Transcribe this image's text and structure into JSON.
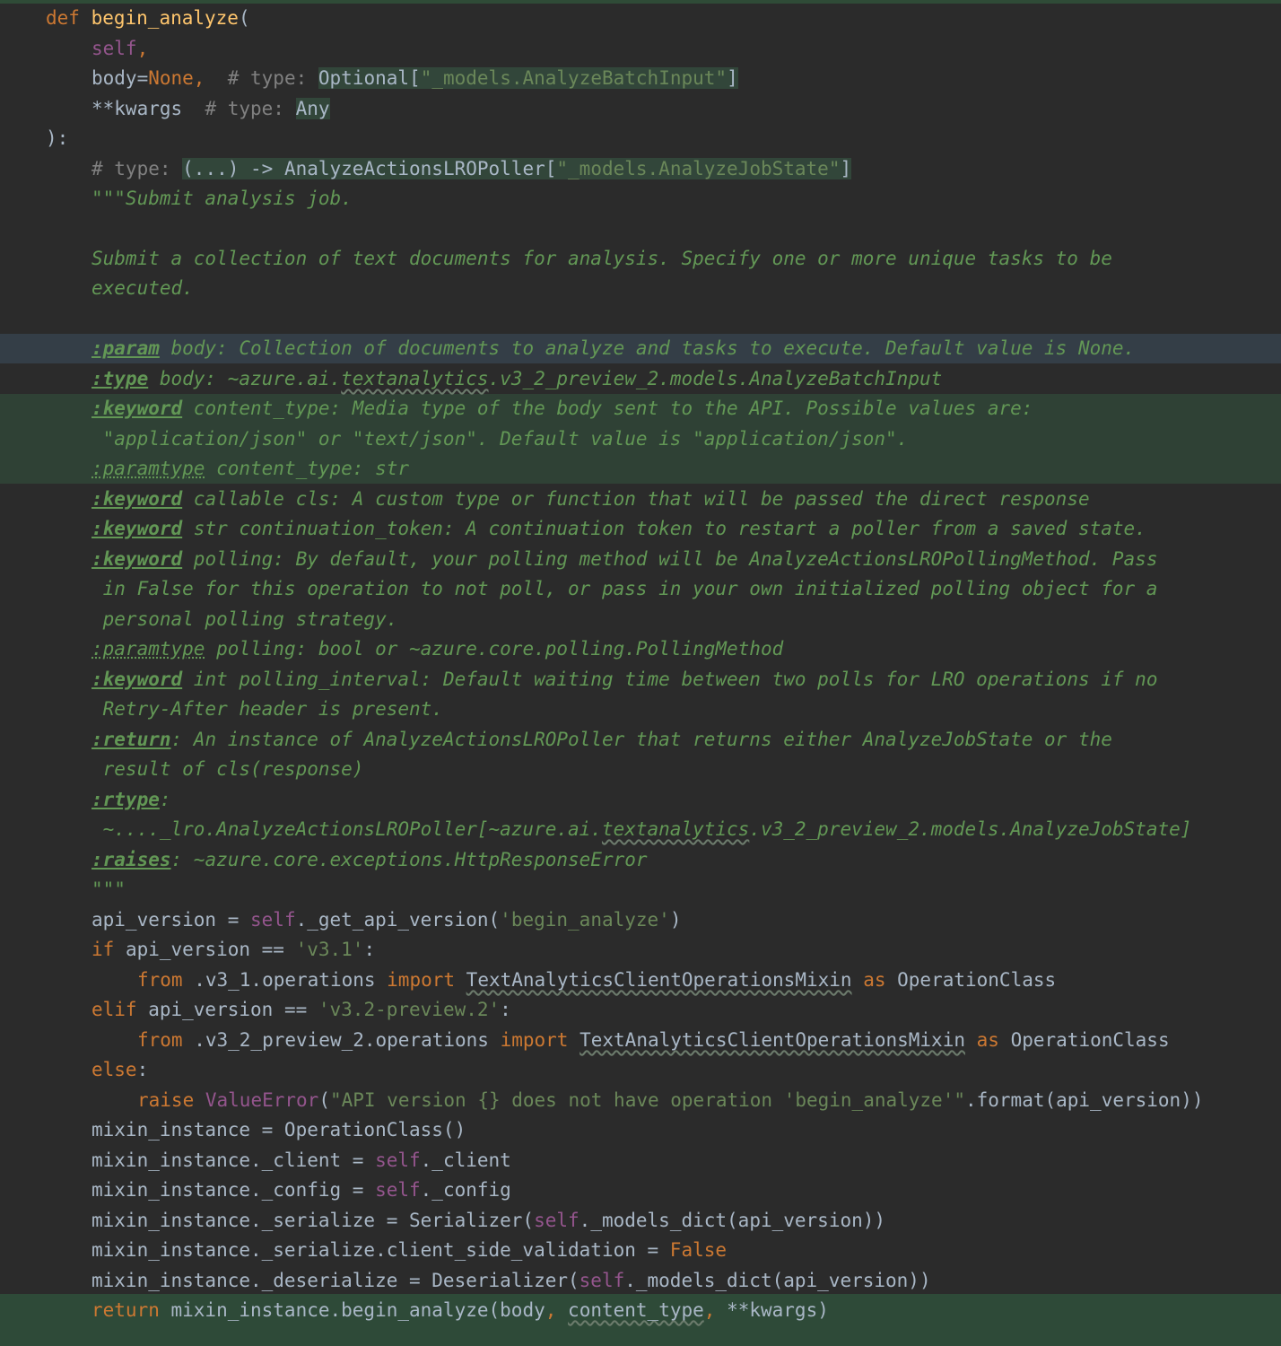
{
  "code": {
    "l1": {
      "kw": "def",
      "fn": "begin_analyze",
      "rest": "("
    },
    "l2": {
      "self": "self",
      "rest": ","
    },
    "l3": {
      "p": "body=",
      "none": "None",
      "sep": ",  ",
      "cmt": "# type: ",
      "hint_a": "Optional[",
      "hint_s": "\"_models.AnalyzeBatchInput\"",
      "hint_b": "]"
    },
    "l4": {
      "p": "**kwargs  ",
      "cmt": "# type: ",
      "hint": "Any"
    },
    "l5": {
      "text": "):"
    },
    "l6": {
      "cmt": "# type: ",
      "hint_a": "(...) -> AnalyzeActionsLROPoller[",
      "hint_s": "\"_models.AnalyzeJobState\"",
      "hint_b": "]"
    },
    "l7": {
      "text": "\"\"\"Submit analysis job."
    },
    "l9": {
      "text": "Submit a collection of text documents for analysis. Specify one or more unique tasks to be"
    },
    "l10": {
      "text": "executed."
    },
    "l12": {
      "tag": ":param",
      "text": " body: Collection of documents to analyze and tasks to execute. Default value is None."
    },
    "l13": {
      "tag": ":type",
      "t1": " body: ~azure.ai.",
      "wavy": "textanalytics",
      "t2": ".v3_2_preview_2.models.AnalyzeBatchInput"
    },
    "l14": {
      "tag": ":keyword",
      "text": " content_type: Media type of the body sent to the API. Possible values are:"
    },
    "l15": {
      "text": " \"application/json\" or \"text/json\". Default value is \"application/json\"."
    },
    "l16": {
      "tag": ":paramtype",
      "text": " content_type: str"
    },
    "l17": {
      "tag": ":keyword",
      "text": " callable cls: A custom type or function that will be passed the direct response"
    },
    "l18": {
      "tag": ":keyword",
      "text": " str continuation_token: A continuation token to restart a poller from a saved state."
    },
    "l19": {
      "tag": ":keyword",
      "text": " polling: By default, your polling method will be AnalyzeActionsLROPollingMethod. Pass"
    },
    "l20": {
      "text": " in False for this operation to not poll, or pass in your own initialized polling object for a"
    },
    "l21": {
      "text": " personal polling strategy."
    },
    "l22": {
      "tag": ":paramtype",
      "text": " polling: bool or ~azure.core.polling.PollingMethod"
    },
    "l23": {
      "tag": ":keyword",
      "text": " int polling_interval: Default waiting time between two polls for LRO operations if no"
    },
    "l24": {
      "text": " Retry-After header is present."
    },
    "l25": {
      "tag": ":return",
      "text": ": An instance of AnalyzeActionsLROPoller that returns either AnalyzeJobState or the"
    },
    "l26": {
      "text": " result of cls(response)"
    },
    "l27": {
      "tag": ":rtype",
      "text": ":"
    },
    "l28": {
      "t1": " ~...._lro.AnalyzeActionsLROPoller[~azure.ai.",
      "wavy": "textanalytics",
      "t2": ".v3_2_preview_2.models.AnalyzeJobState]"
    },
    "l29": {
      "tag": ":raises",
      "text": ": ~azure.core.exceptions.HttpResponseError"
    },
    "l30": {
      "text": "\"\"\""
    },
    "l31": {
      "a": "api_version = ",
      "self": "self",
      "b": "._get_api_version(",
      "s": "'begin_analyze'",
      "c": ")"
    },
    "l32": {
      "kw": "if",
      "a": " api_version == ",
      "s": "'v3.1'",
      "c": ":"
    },
    "l33": {
      "kw1": "from",
      "a": " .v3_1.operations ",
      "kw2": "import",
      "sp": " ",
      "wavy": "TextAnalyticsClientOperationsMixin",
      "sp2": " ",
      "kw3": "as",
      "b": " OperationClass"
    },
    "l34": {
      "kw": "elif",
      "a": " api_version == ",
      "s": "'v3.2-preview.2'",
      "c": ":"
    },
    "l35": {
      "kw1": "from",
      "a": " .v3_2_preview_2.operations ",
      "kw2": "import",
      "sp": " ",
      "wavy": "TextAnalyticsClientOperationsMixin",
      "sp2": " ",
      "kw3": "as",
      "b": " OperationClass"
    },
    "l36": {
      "kw": "else",
      "c": ":"
    },
    "l37": {
      "kw": "raise",
      "sp": " ",
      "cls": "ValueError",
      "a": "(",
      "s": "\"API version {} does not have operation 'begin_analyze'\"",
      "b": ".format(api_version))"
    },
    "l38": {
      "text": "mixin_instance = OperationClass()"
    },
    "l39": {
      "a": "mixin_instance._client = ",
      "self": "self",
      "b": "._client"
    },
    "l40": {
      "a": "mixin_instance._config = ",
      "self": "self",
      "b": "._config"
    },
    "l41": {
      "a": "mixin_instance._serialize = Serializer(",
      "self": "self",
      "b": "._models_dict(api_version))"
    },
    "l42": {
      "a": "mixin_instance._serialize.client_side_validation = ",
      "kw": "False"
    },
    "l43": {
      "a": "mixin_instance._deserialize = Deserializer(",
      "self": "self",
      "b": "._models_dict(api_version))"
    },
    "l44": {
      "kw": "return",
      "a": " mixin_instance.begin_analyze(body",
      "c1": ",",
      "sp": " ",
      "wavy": "content_type",
      "c2": ",",
      "b": " **kwargs)"
    }
  }
}
